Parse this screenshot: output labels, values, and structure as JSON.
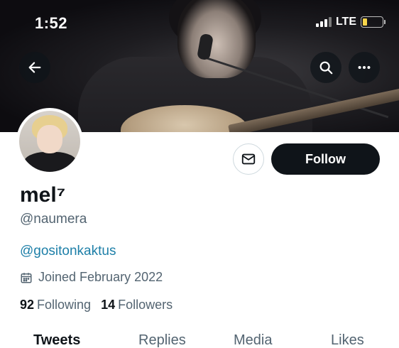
{
  "status_bar": {
    "time": "1:52",
    "network": "LTE",
    "battery_level": 0.24
  },
  "header": {
    "back_icon": "arrow-left-icon",
    "search_icon": "search-icon",
    "more_icon": "more-horizontal-icon"
  },
  "profile": {
    "display_name": "mel⁷",
    "handle": "@naumera",
    "bio": "@gositonkaktus",
    "joined": "Joined February 2022",
    "following_count": "92",
    "following_label": "Following",
    "followers_count": "14",
    "followers_label": "Followers"
  },
  "actions": {
    "message_icon": "envelope-icon",
    "follow_label": "Follow"
  },
  "tabs": [
    {
      "label": "Tweets",
      "active": true
    },
    {
      "label": "Replies",
      "active": false
    },
    {
      "label": "Media",
      "active": false
    },
    {
      "label": "Likes",
      "active": false
    }
  ],
  "colors": {
    "text_primary": "#0f1419",
    "text_secondary": "#536471",
    "link": "#1d7fa8",
    "follow_bg": "#0f1419"
  }
}
